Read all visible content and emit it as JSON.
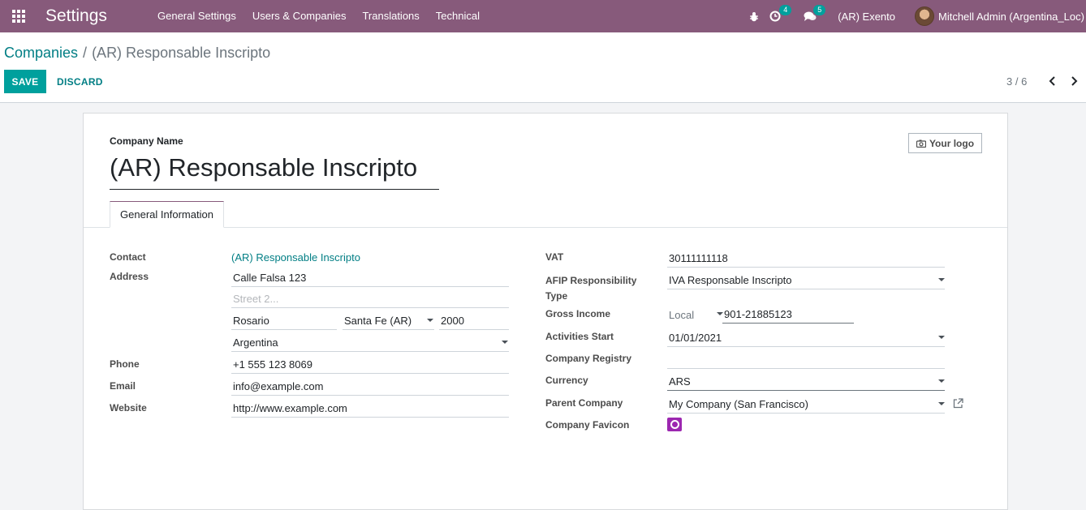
{
  "navbar": {
    "app_name": "Settings",
    "menu": [
      "General Settings",
      "Users & Companies",
      "Translations",
      "Technical"
    ],
    "activity_count": "4",
    "messages_count": "5",
    "company_switcher": "(AR) Exento",
    "user_name": "Mitchell Admin (Argentina_Loc)"
  },
  "breadcrumb": {
    "parent": "Companies",
    "separator": "/",
    "current": "(AR) Responsable Inscripto"
  },
  "actions": {
    "save": "SAVE",
    "discard": "DISCARD"
  },
  "pager": {
    "value": "3 / 6"
  },
  "form": {
    "company_name_label": "Company Name",
    "company_name": "(AR) Responsable Inscripto",
    "logo_button": "Your logo",
    "tab": "General Information",
    "left": {
      "contact_label": "Contact",
      "contact_value": "(AR) Responsable Inscripto",
      "address_label": "Address",
      "street": "Calle Falsa 123",
      "street2_placeholder": "Street 2...",
      "city": "Rosario",
      "state": "Santa Fe (AR)",
      "zip": "2000",
      "country": "Argentina",
      "phone_label": "Phone",
      "phone": "+1 555 123 8069",
      "email_label": "Email",
      "email": "info@example.com",
      "website_label": "Website",
      "website": "http://www.example.com"
    },
    "right": {
      "vat_label": "VAT",
      "vat": "30111111118",
      "afip_label_1": "AFIP Responsibility",
      "afip_label_2": "Type",
      "afip": "IVA Responsable Inscripto",
      "gross_income_label": "Gross Income",
      "gross_income_type": "Local",
      "gross_income": "901-21885123",
      "activities_start_label": "Activities Start",
      "activities_start": "01/01/2021",
      "company_registry_label": "Company Registry",
      "company_registry": "",
      "currency_label": "Currency",
      "currency": "ARS",
      "parent_company_label": "Parent Company",
      "parent_company": "My Company (San Francisco)",
      "favicon_label": "Company Favicon"
    }
  },
  "colors": {
    "navbar": "#875a7b",
    "primary": "#00a09d",
    "link": "#017e84"
  }
}
